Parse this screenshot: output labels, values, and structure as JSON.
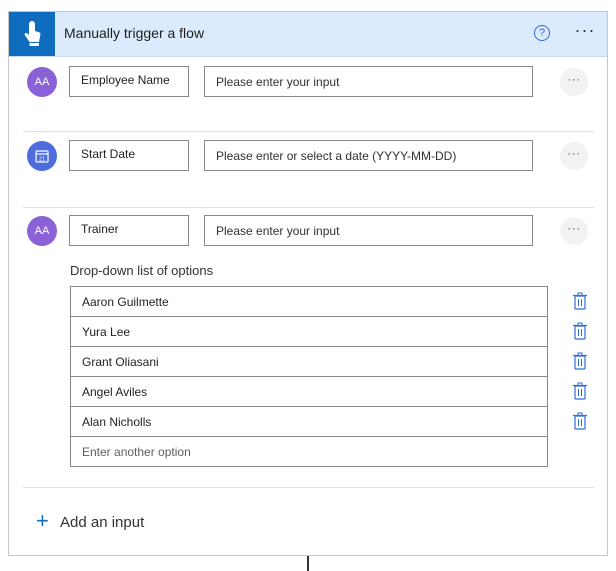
{
  "header": {
    "title": "Manually trigger a flow",
    "help_glyph": "?",
    "more_glyph": "···"
  },
  "inputs": [
    {
      "icon": "text-type-icon",
      "icon_text": "AA",
      "name": "Employee Name",
      "placeholder": "Please enter your input"
    },
    {
      "icon": "calendar-icon",
      "icon_text": "21",
      "name": "Start Date",
      "placeholder": "Please enter or select a date (YYYY-MM-DD)"
    },
    {
      "icon": "text-type-icon",
      "icon_text": "AA",
      "name": "Trainer",
      "placeholder": "Please enter your input"
    }
  ],
  "row_more_glyph": "···",
  "dropdown": {
    "label": "Drop-down list of options",
    "options": [
      "Aaron Guilmette",
      "Yura Lee",
      "Grant Oliasani",
      "Angel Aviles",
      "Alan Nicholls"
    ],
    "add_placeholder": "Enter another option"
  },
  "add_input": {
    "plus": "+",
    "label": "Add an input"
  },
  "colors": {
    "accent": "#0f6cbd",
    "header_bg": "#dbeafd",
    "text_icon": "#8a61d6",
    "date_icon": "#4e6cdc",
    "trash": "#2b6ddb"
  }
}
